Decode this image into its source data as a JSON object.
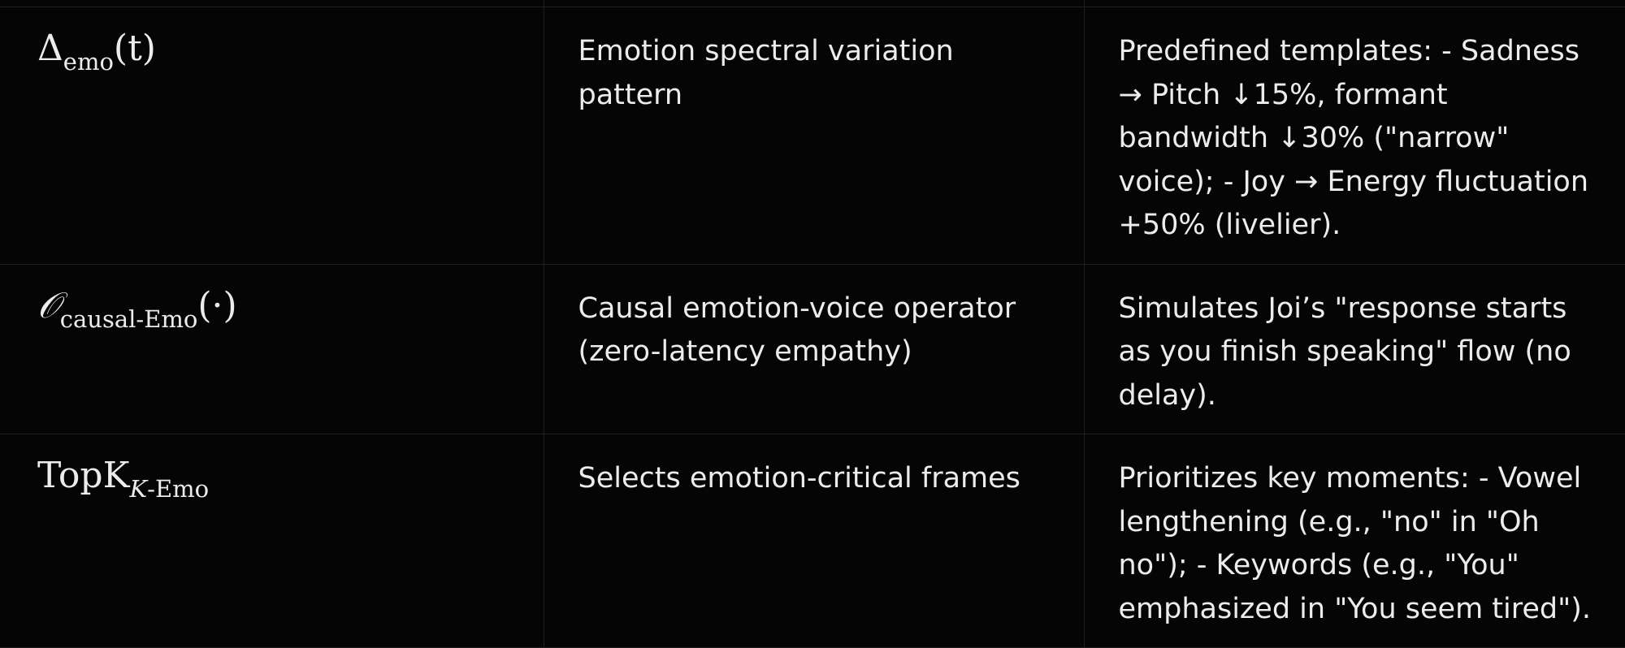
{
  "rows": [
    {
      "symbol": {
        "base": "Δ",
        "sub": "emo",
        "arg": "(t)"
      },
      "description": "Emotion spectral variation pattern",
      "details": "Predefined templates: - Sadness → Pitch ↓15%, formant bandwidth ↓30% (\"narrow\" voice); - Joy → Energy fluctuation +50% (livelier)."
    },
    {
      "symbol": {
        "base": "𝒪",
        "sub": "causal-Emo",
        "arg": "(·)"
      },
      "description": "Causal emotion-voice operator (zero-latency empathy)",
      "details": "Simulates Joi’s \"response starts as you finish speaking\" flow (no delay)."
    },
    {
      "symbol": {
        "base": "TopK",
        "sub_italic": "K",
        "sub": "-Emo",
        "arg": ""
      },
      "description": "Selects emotion-critical frames",
      "details": "Prioritizes key moments: - Vowel lengthening (e.g., \"no\" in \"Oh no\"); - Keywords (e.g., \"You\" emphasized in \"You seem tired\")."
    }
  ],
  "colors": {
    "background": "#050505",
    "text": "#ececec",
    "border": "#1f1f1f"
  }
}
